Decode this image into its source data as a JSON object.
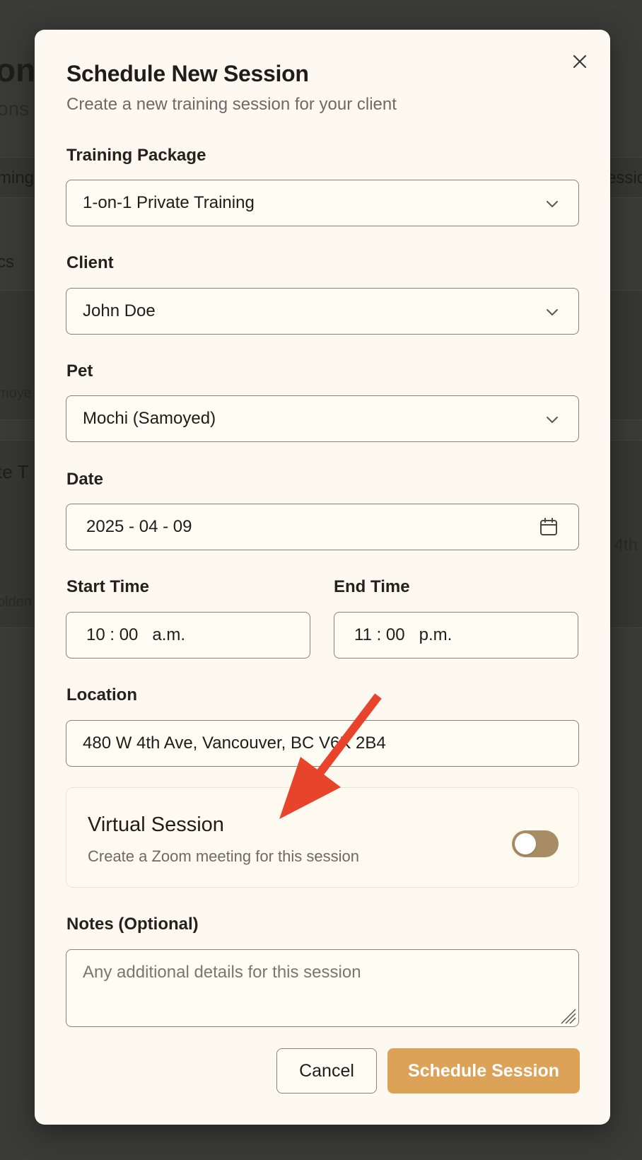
{
  "background": {
    "title_fragment": "on",
    "subtitle_fragment": "ons",
    "tab_left_fragment": "ming",
    "tab_right_fragment": "essio",
    "chip_fragment": "cs",
    "card1_fragment": "moye",
    "card2_title_fragment": "te T",
    "card2_sub_fragment": "olden",
    "card2_right_fragment": "4th"
  },
  "modal": {
    "title": "Schedule New Session",
    "subtitle": "Create a new training session for your client",
    "close_icon": "close-icon"
  },
  "form": {
    "package": {
      "label": "Training Package",
      "value": "1-on-1 Private Training"
    },
    "client": {
      "label": "Client",
      "value": "John Doe"
    },
    "pet": {
      "label": "Pet",
      "value": "Mochi (Samoyed)"
    },
    "date": {
      "label": "Date",
      "value": "2025 - 04 - 09"
    },
    "start_time": {
      "label": "Start Time",
      "value": "10 : 00   a.m."
    },
    "end_time": {
      "label": "End Time",
      "value": "11 : 00   p.m."
    },
    "location": {
      "label": "Location",
      "value": "480 W 4th Ave, Vancouver, BC V6K 2B4"
    },
    "virtual": {
      "title": "Virtual Session",
      "description": "Create a Zoom meeting for this session",
      "enabled": false
    },
    "notes": {
      "label": "Notes (Optional)",
      "placeholder": "Any additional details for this session"
    }
  },
  "actions": {
    "cancel_label": "Cancel",
    "submit_label": "Schedule Session"
  },
  "colors": {
    "primary": "#dca257",
    "toggle_track": "#a88c64",
    "annotation_arrow": "#e8432b",
    "modal_bg": "#fdf9f1"
  }
}
